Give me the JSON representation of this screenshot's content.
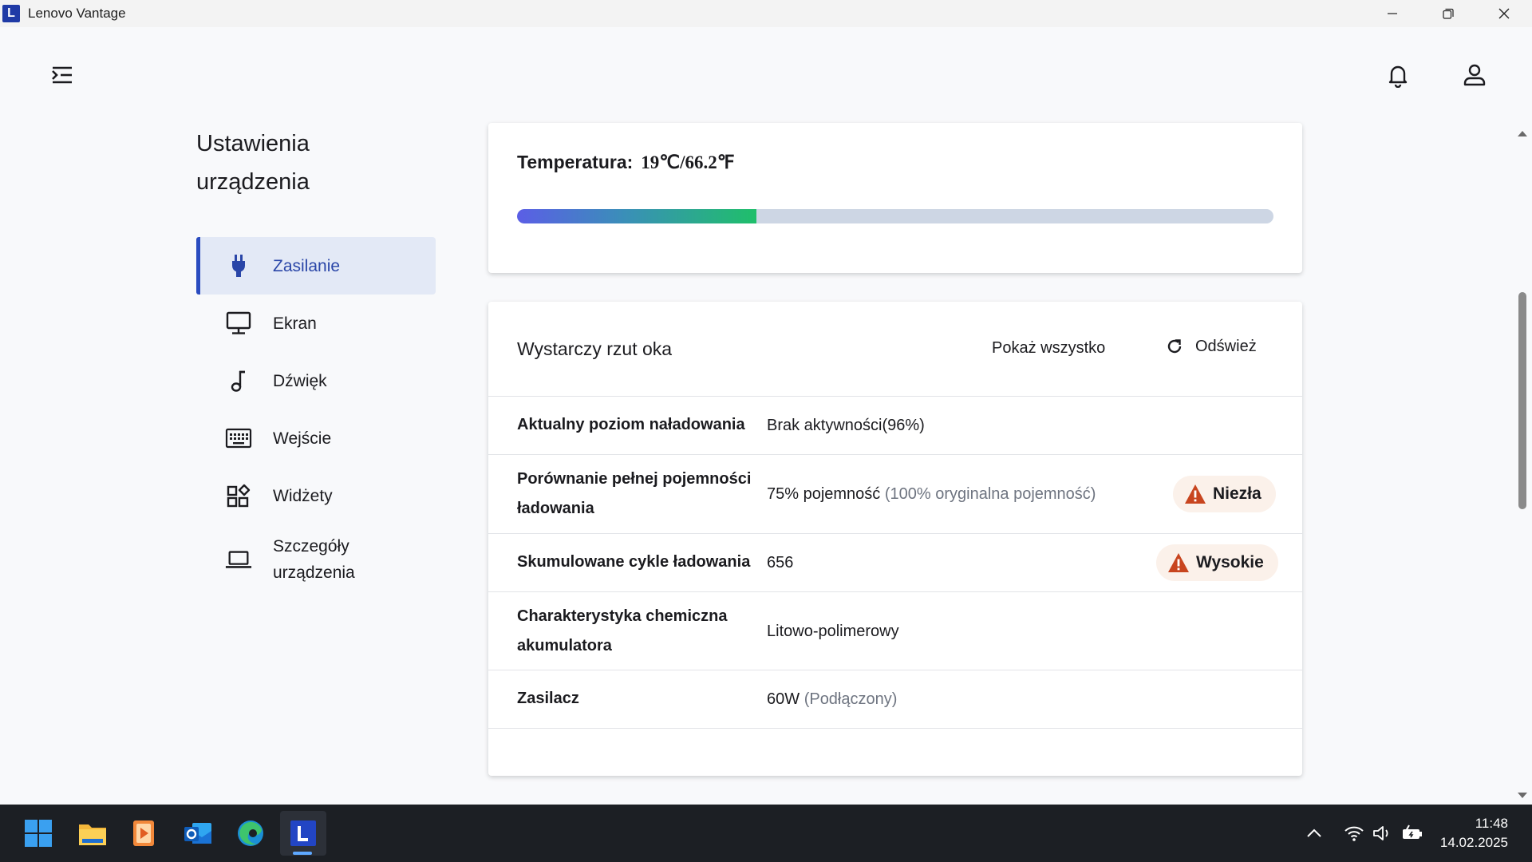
{
  "window": {
    "title": "Lenovo Vantage",
    "logo_letter": "L"
  },
  "sidebar": {
    "title": "Ustawienia urządzenia",
    "items": [
      {
        "label": "Zasilanie",
        "icon": "plug-icon",
        "active": true
      },
      {
        "label": "Ekran",
        "icon": "monitor-icon"
      },
      {
        "label": "Dźwięk",
        "icon": "music-note-icon"
      },
      {
        "label": "Wejście",
        "icon": "keyboard-icon"
      },
      {
        "label": "Widżety",
        "icon": "widgets-icon"
      },
      {
        "label": "Szczegóły urządzenia",
        "icon": "laptop-icon"
      }
    ]
  },
  "temperature": {
    "label": "Temperatura:",
    "value": "19℃/66.2℉",
    "level_fraction": 0.316,
    "colors": {
      "start": "#5b5ee6",
      "end": "#1fbf6a",
      "track": "#cdd6e4"
    }
  },
  "glance": {
    "title": "Wystarczy rzut oka",
    "show_all": "Pokaż wszystko",
    "refresh": "Odśwież",
    "rows": [
      {
        "label": "Aktualny poziom naładowania",
        "value": "Brak aktywności(96%)",
        "muted": ""
      },
      {
        "label": "Porównanie pełnej pojemności ładowania",
        "value": "75% pojemność",
        "muted": "(100% oryginalna pojemność)",
        "badge": "Niezła"
      },
      {
        "label": "Skumulowane cykle ładowania",
        "value": "656",
        "muted": "",
        "badge": "Wysokie"
      },
      {
        "label": "Charakterystyka chemiczna akumulatora",
        "value": "Litowo-polimerowy",
        "muted": ""
      },
      {
        "label": "Zasilacz",
        "value": "60W",
        "muted": "(Podłączony)"
      }
    ],
    "badge_color": "#c8451f"
  },
  "taskbar": {
    "time": "11:48",
    "date": "14.02.2025",
    "apps": [
      "start-icon",
      "file-explorer-icon",
      "media-player-icon",
      "outlook-icon",
      "edge-icon",
      "lenovo-vantage-icon"
    ]
  },
  "accent": "#2a4cc0"
}
